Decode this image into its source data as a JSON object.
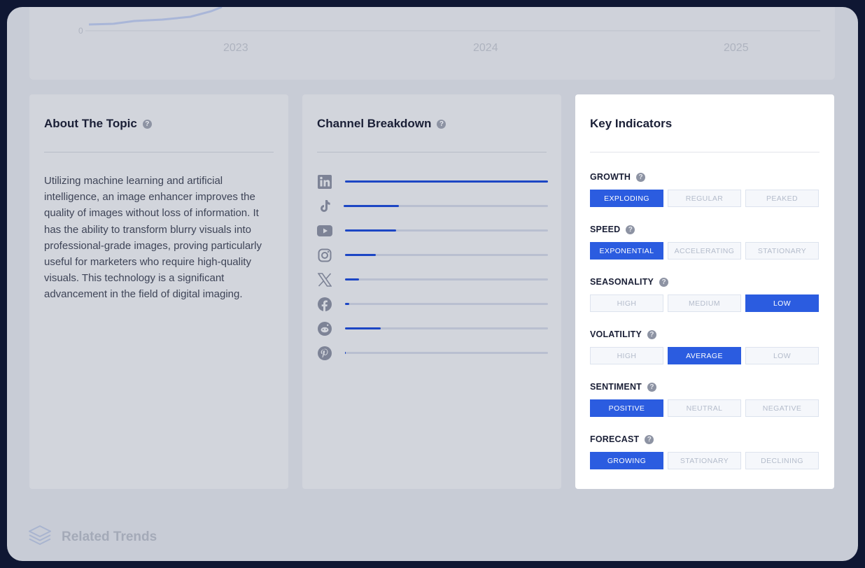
{
  "chart": {
    "zero_label": "0",
    "years": [
      "2023",
      "2024",
      "2025"
    ]
  },
  "about": {
    "title": "About The Topic",
    "text": "Utilizing machine learning and artificial intelligence, an image enhancer improves the quality of images without loss of information. It has the ability to transform blurry visuals into professional-grade images, proving particularly useful for marketers who require high-quality visuals. This technology is a significant advancement in the field of digital imaging."
  },
  "channels": {
    "title": "Channel Breakdown",
    "items": [
      {
        "icon": "linkedin-icon",
        "share": 1.0
      },
      {
        "icon": "tiktok-icon",
        "share": 0.27
      },
      {
        "icon": "youtube-icon",
        "share": 0.25
      },
      {
        "icon": "instagram-icon",
        "share": 0.15
      },
      {
        "icon": "x-icon",
        "share": 0.07
      },
      {
        "icon": "facebook-icon",
        "share": 0.02
      },
      {
        "icon": "reddit-icon",
        "share": 0.175
      },
      {
        "icon": "pinterest-icon",
        "share": 0.005
      }
    ]
  },
  "indicators": {
    "title": "Key Indicators",
    "items": [
      {
        "label": "GROWTH",
        "options": [
          "EXPLODING",
          "REGULAR",
          "PEAKED"
        ],
        "selected": 0
      },
      {
        "label": "SPEED",
        "options": [
          "EXPONENTIAL",
          "ACCELERATING",
          "STATIONARY"
        ],
        "selected": 0
      },
      {
        "label": "SEASONALITY",
        "options": [
          "HIGH",
          "MEDIUM",
          "LOW"
        ],
        "selected": 2
      },
      {
        "label": "VOLATILITY",
        "options": [
          "HIGH",
          "AVERAGE",
          "LOW"
        ],
        "selected": 1
      },
      {
        "label": "SENTIMENT",
        "options": [
          "POSITIVE",
          "NEUTRAL",
          "NEGATIVE"
        ],
        "selected": 0
      },
      {
        "label": "FORECAST",
        "options": [
          "GROWING",
          "STATIONARY",
          "DECLINING"
        ],
        "selected": 0
      }
    ]
  },
  "related": {
    "title": "Related Trends",
    "icon": "layers-icon"
  },
  "colors": {
    "accent": "#2b5ce0",
    "bar": "#1c46c4"
  }
}
